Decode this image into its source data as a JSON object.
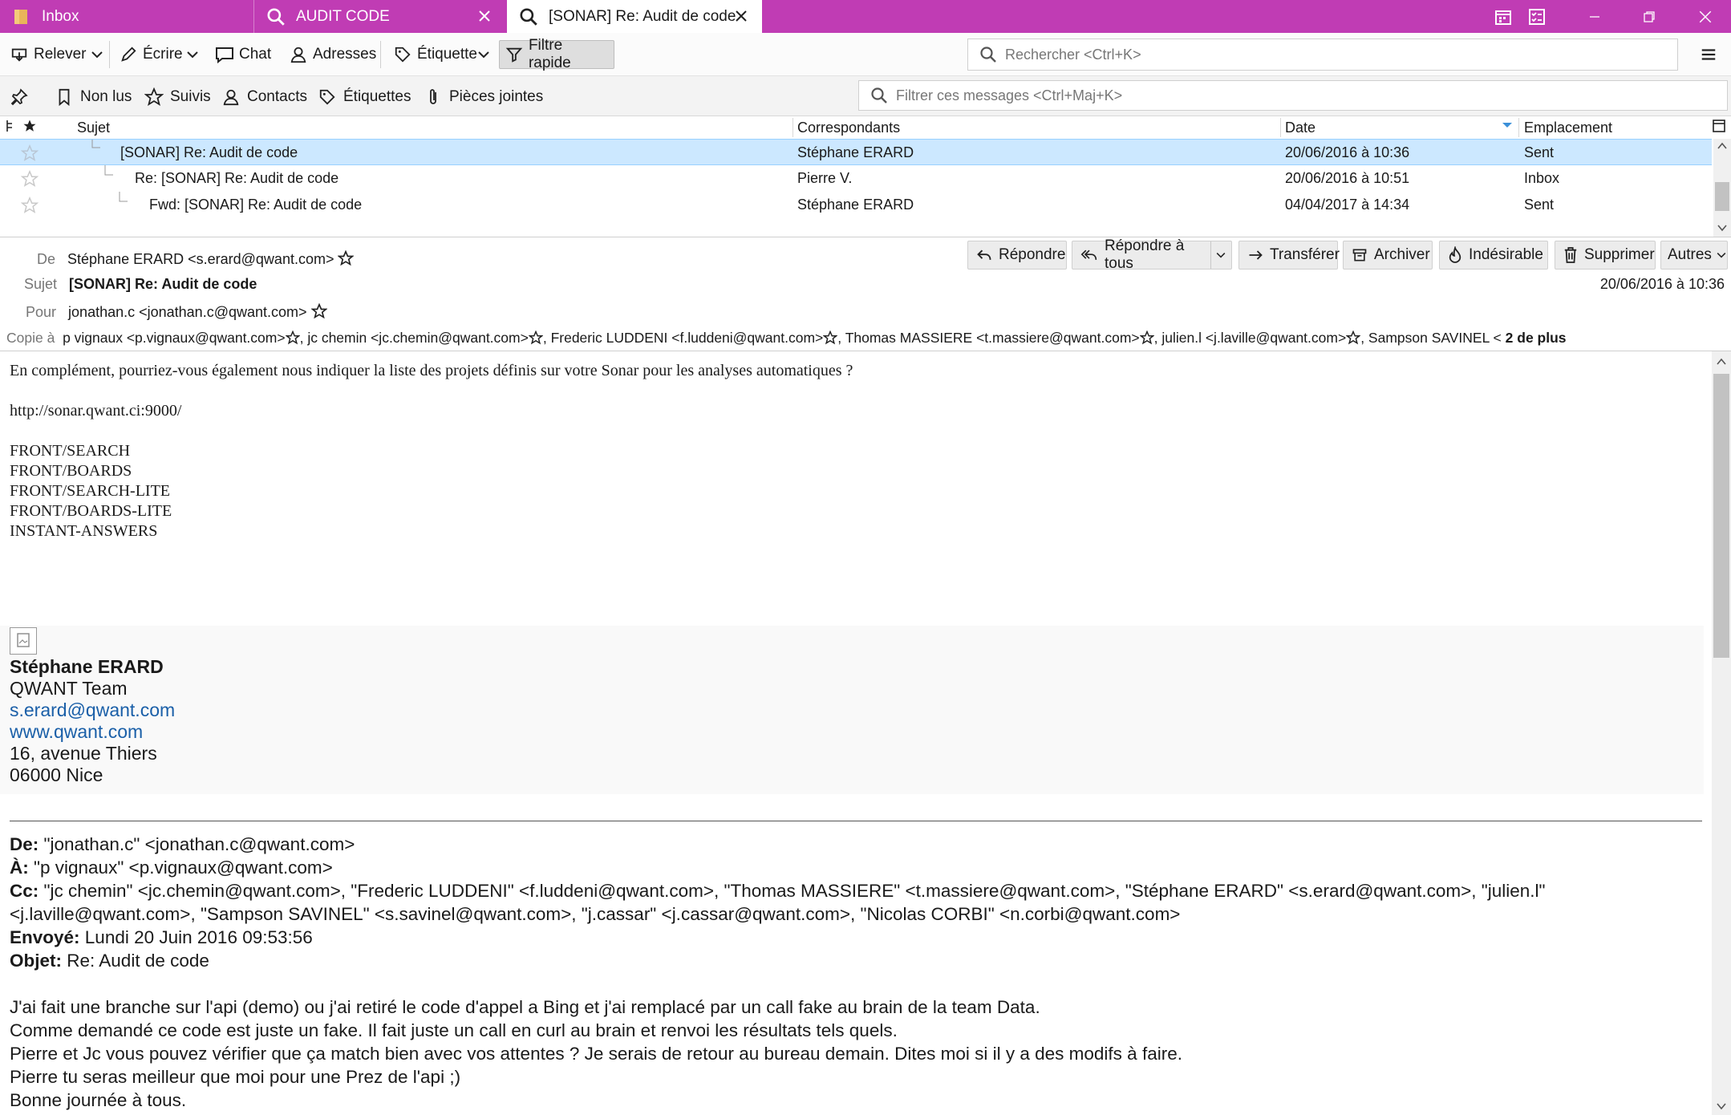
{
  "tabs": [
    {
      "label": "Inbox",
      "icon": "folder-icon"
    },
    {
      "label": "AUDIT CODE",
      "icon": "search-icon"
    },
    {
      "label": "[SONAR] Re: Audit de code",
      "icon": "search-icon"
    }
  ],
  "toolbar": {
    "get_mail": "Relever",
    "write": "Écrire",
    "chat": "Chat",
    "address_book": "Adresses",
    "tag": "Étiquette",
    "quick_filter": "Filtre rapide"
  },
  "search": {
    "placeholder": "Rechercher <Ctrl+K>"
  },
  "filterbar": {
    "unread": "Non lus",
    "starred": "Suivis",
    "contacts": "Contacts",
    "tags": "Étiquettes",
    "attachments": "Pièces jointes",
    "filter_placeholder": "Filtrer ces messages <Ctrl+Maj+K>"
  },
  "thread": {
    "columns": [
      "Sujet",
      "Correspondants",
      "Date",
      "Emplacement"
    ],
    "rows": [
      {
        "subject": "[SONAR] Re: Audit de code",
        "from": "Stéphane ERARD",
        "date": "20/06/2016 à 10:36",
        "location": "Sent",
        "selected": true
      },
      {
        "subject": "Re: [SONAR] Re: Audit de code",
        "from": "Pierre V.",
        "date": "20/06/2016 à 10:51",
        "location": "Inbox",
        "selected": false
      },
      {
        "subject": "Fwd: [SONAR] Re: Audit de code",
        "from": "Stéphane ERARD",
        "date": "04/04/2017 à 14:34",
        "location": "Sent",
        "selected": false
      }
    ]
  },
  "header": {
    "from_label": "De",
    "from": "Stéphane ERARD <s.erard@qwant.com>",
    "subject_label": "Sujet",
    "subject": "[SONAR] Re: Audit de code",
    "to_label": "Pour",
    "to": "jonathan.c <jonathan.c@qwant.com>",
    "cc_label": "Copie à",
    "cc": [
      "p vignaux <p.vignaux@qwant.com>",
      "jc chemin <jc.chemin@qwant.com>",
      "Frederic LUDDENI <f.luddeni@qwant.com>",
      "Thomas MASSIERE <t.massiere@qwant.com>",
      "julien.l <j.laville@qwant.com>",
      "Sampson SAVINEL <"
    ],
    "more": "2 de plus",
    "date": "20/06/2016 à 10:36",
    "actions": {
      "reply": "Répondre",
      "reply_all": "Répondre à tous",
      "forward": "Transférer",
      "archive": "Archiver",
      "junk": "Indésirable",
      "delete": "Supprimer",
      "other": "Autres"
    }
  },
  "body": {
    "intro": "En complément, pourriez-vous également nous indiquer la liste des projets définis sur votre Sonar pour les analyses automatiques ?",
    "url": "http://sonar.qwant.ci:9000/",
    "projects": [
      "FRONT/SEARCH",
      "FRONT/BOARDS",
      "FRONT/SEARCH-LITE",
      "FRONT/BOARDS-LITE",
      "INSTANT-ANSWERS"
    ],
    "signature": {
      "name": "Stéphane ERARD",
      "team": "QWANT Team",
      "email": "s.erard@qwant.com",
      "web": "www.qwant.com",
      "address1": "16, avenue Thiers",
      "address2": "06000 Nice"
    },
    "quote": {
      "from_label": "De:",
      "from": "\"jonathan.c\" <jonathan.c@qwant.com>",
      "to_label": "À:",
      "to": "\"p vignaux\" <p.vignaux@qwant.com>",
      "cc_label": "Cc:",
      "cc_line1": "\"jc chemin\" <jc.chemin@qwant.com>, \"Frederic LUDDENI\" <f.luddeni@qwant.com>, \"Thomas MASSIERE\" <t.massiere@qwant.com>, \"Stéphane ERARD\" <s.erard@qwant.com>, \"julien.l\"",
      "cc_line2": "<j.laville@qwant.com>, \"Sampson SAVINEL\" <s.savinel@qwant.com>, \"j.cassar\" <j.cassar@qwant.com>, \"Nicolas CORBI\" <n.corbi@qwant.com>",
      "sent_label": "Envoyé:",
      "sent": "Lundi 20 Juin 2016 09:53:56",
      "subject_label": "Objet:",
      "subject": "Re: Audit de code",
      "lines": [
        "J'ai fait une branche sur l'api (demo) ou j'ai retiré le code d'appel a Bing et j'ai remplacé  par un call fake au brain de la team Data.",
        "Comme demandé ce code est juste un fake. Il fait juste un call en curl au brain et renvoi les résultats tels quels.",
        "Pierre et Jc vous pouvez vérifier que ça match bien avec vos attentes ? Je serais de retour au bureau demain. Dites moi si il y a des modifs à faire.",
        "Pierre tu seras meilleur que moi pour une Prez de l'api ;)",
        "Bonne journée à tous."
      ]
    }
  },
  "colors": {
    "tab_accent": "#c03cb4",
    "selected_row": "#cce8ff",
    "link": "#1a5fa8"
  }
}
